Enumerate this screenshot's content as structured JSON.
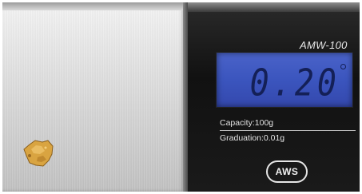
{
  "scale": {
    "model": "AMW-100",
    "reading": "0.20",
    "capacity": "Capacity:100g",
    "graduation": "Graduation:0.01g",
    "brand": "AWS",
    "lcd_color": "#3b55be",
    "body_color": "#151515",
    "platform_color": "#d8d8d8"
  },
  "sample": {
    "item": "gold-nugget",
    "color": "#d9a441"
  }
}
